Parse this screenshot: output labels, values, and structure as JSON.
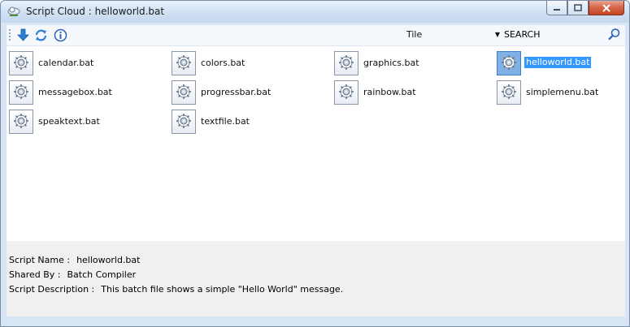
{
  "window": {
    "title": "Script Cloud : helloworld.bat"
  },
  "toolbar": {
    "download_icon": "download-arrow-icon",
    "refresh_icon": "refresh-icon",
    "info_icon": "info-icon",
    "view_mode": "Tile",
    "search_label": "SEARCH"
  },
  "files": [
    {
      "name": "calendar.bat",
      "selected": false
    },
    {
      "name": "colors.bat",
      "selected": false
    },
    {
      "name": "graphics.bat",
      "selected": false
    },
    {
      "name": "helloworld.bat",
      "selected": true
    },
    {
      "name": "messagebox.bat",
      "selected": false
    },
    {
      "name": "progressbar.bat",
      "selected": false
    },
    {
      "name": "rainbow.bat",
      "selected": false
    },
    {
      "name": "simplemenu.bat",
      "selected": false
    },
    {
      "name": "speaktext.bat",
      "selected": false
    },
    {
      "name": "textfile.bat",
      "selected": false
    }
  ],
  "details": {
    "name_label": "Script Name :",
    "name_value": "helloworld.bat",
    "shared_label": "Shared By :",
    "shared_value": "Batch Compiler",
    "desc_label": "Script Description :",
    "desc_value": "This batch file shows a simple \"Hello World\" message."
  },
  "colors": {
    "selection": "#3399ff",
    "title_bar": "#d4e3f5",
    "close_button": "#c44523"
  }
}
